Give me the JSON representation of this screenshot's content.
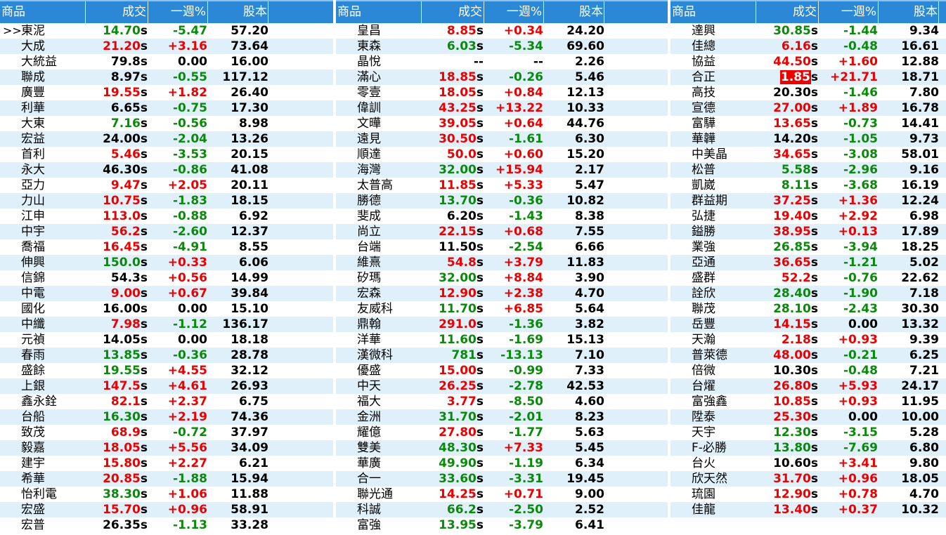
{
  "headers": {
    "name": "商品",
    "price": "成交",
    "change": "一週%",
    "capital": "股本"
  },
  "current_marker": ">>",
  "colors": {
    "header_bg": "#2b88d6",
    "up": "#ee0000",
    "down": "#0a8a0a",
    "row_alt": "#dff0fb"
  },
  "panels": [
    {
      "rows": [
        {
          "name": "東泥",
          "price": "14.70",
          "s": "s",
          "change": "-5.47",
          "capital": "57.20",
          "trend": "down",
          "selected": true
        },
        {
          "name": "大成",
          "price": "21.20",
          "s": "s",
          "change": "+3.16",
          "capital": "73.64",
          "trend": "up"
        },
        {
          "name": "大統益",
          "price": "79.8",
          "s": "s",
          "change": "0.00",
          "capital": "16.00",
          "trend": "flat"
        },
        {
          "name": "聯成",
          "price": "8.97",
          "s": "s",
          "change": "-0.55",
          "capital": "117.12",
          "trend": "flat-down"
        },
        {
          "name": "廣豐",
          "price": "19.55",
          "s": "s",
          "change": "+1.82",
          "capital": "26.40",
          "trend": "up"
        },
        {
          "name": "利華",
          "price": "6.65",
          "s": "s",
          "change": "-0.75",
          "capital": "17.30",
          "trend": "flat-down"
        },
        {
          "name": "大東",
          "price": "7.16",
          "s": "s",
          "change": "-0.56",
          "capital": "8.98",
          "trend": "down"
        },
        {
          "name": "宏益",
          "price": "24.00",
          "s": "s",
          "change": "-2.04",
          "capital": "13.26",
          "trend": "flat-down"
        },
        {
          "name": "首利",
          "price": "5.46",
          "s": "s",
          "change": "-3.53",
          "capital": "20.15",
          "trend": "up-down"
        },
        {
          "name": "永大",
          "price": "46.30",
          "s": "s",
          "change": "-0.86",
          "capital": "41.08",
          "trend": "flat-down"
        },
        {
          "name": "亞力",
          "price": "9.47",
          "s": "s",
          "change": "+2.05",
          "capital": "20.11",
          "trend": "up"
        },
        {
          "name": "力山",
          "price": "10.75",
          "s": "s",
          "change": "-1.83",
          "capital": "18.15",
          "trend": "up-down"
        },
        {
          "name": "江申",
          "price": "113.0",
          "s": "s",
          "change": "-0.88",
          "capital": "6.92",
          "trend": "up-down"
        },
        {
          "name": "中宇",
          "price": "56.2",
          "s": "s",
          "change": "-2.60",
          "capital": "12.37",
          "trend": "up-down"
        },
        {
          "name": "喬福",
          "price": "16.45",
          "s": "s",
          "change": "-4.91",
          "capital": "8.55",
          "trend": "up-down"
        },
        {
          "name": "伸興",
          "price": "150.0",
          "s": "s",
          "change": "+0.33",
          "capital": "6.06",
          "trend": "down-up"
        },
        {
          "name": "信錦",
          "price": "54.3",
          "s": "s",
          "change": "+0.56",
          "capital": "14.99",
          "trend": "flat-up"
        },
        {
          "name": "中電",
          "price": "9.00",
          "s": "s",
          "change": "+0.67",
          "capital": "39.84",
          "trend": "up"
        },
        {
          "name": "國化",
          "price": "16.00",
          "s": "s",
          "change": "0.00",
          "capital": "15.10",
          "trend": "flat"
        },
        {
          "name": "中纖",
          "price": "7.98",
          "s": "s",
          "change": "-1.12",
          "capital": "136.17",
          "trend": "up-down"
        },
        {
          "name": "元禎",
          "price": "14.05",
          "s": "s",
          "change": "0.00",
          "capital": "18.18",
          "trend": "flat"
        },
        {
          "name": "春雨",
          "price": "13.85",
          "s": "s",
          "change": "-0.36",
          "capital": "28.78",
          "trend": "down"
        },
        {
          "name": "盛餘",
          "price": "19.55",
          "s": "s",
          "change": "+4.55",
          "capital": "32.12",
          "trend": "down-up"
        },
        {
          "name": "上銀",
          "price": "147.5",
          "s": "s",
          "change": "+4.61",
          "capital": "26.93",
          "trend": "up"
        },
        {
          "name": "鑫永銓",
          "price": "82.1",
          "s": "s",
          "change": "+2.37",
          "capital": "6.75",
          "trend": "up"
        },
        {
          "name": "台船",
          "price": "16.30",
          "s": "s",
          "change": "+2.19",
          "capital": "74.36",
          "trend": "down-up"
        },
        {
          "name": "致茂",
          "price": "68.9",
          "s": "s",
          "change": "-0.72",
          "capital": "37.97",
          "trend": "up-down"
        },
        {
          "name": "毅嘉",
          "price": "18.05",
          "s": "s",
          "change": "+5.56",
          "capital": "34.09",
          "trend": "up"
        },
        {
          "name": "建宇",
          "price": "15.80",
          "s": "s",
          "change": "+2.27",
          "capital": "6.21",
          "trend": "up"
        },
        {
          "name": "希華",
          "price": "20.85",
          "s": "s",
          "change": "-1.88",
          "capital": "15.94",
          "trend": "up-down"
        },
        {
          "name": "怡利電",
          "price": "38.30",
          "s": "s",
          "change": "+1.06",
          "capital": "11.88",
          "trend": "down-up"
        },
        {
          "name": "宏盛",
          "price": "15.70",
          "s": "s",
          "change": "+0.96",
          "capital": "58.91",
          "trend": "up"
        },
        {
          "name": "宏普",
          "price": "26.35",
          "s": "s",
          "change": "-1.13",
          "capital": "33.28",
          "trend": "flat-down"
        }
      ]
    },
    {
      "rows": [
        {
          "name": "皇昌",
          "price": "8.85",
          "s": "s",
          "change": "+0.34",
          "capital": "24.20",
          "trend": "up"
        },
        {
          "name": "東森",
          "price": "6.03",
          "s": "s",
          "change": "-5.34",
          "capital": "69.60",
          "trend": "down"
        },
        {
          "name": "晶悅",
          "price": "--",
          "s": "",
          "change": "--",
          "capital": "2.26",
          "trend": "flat"
        },
        {
          "name": "滿心",
          "price": "18.85",
          "s": "s",
          "change": "-0.26",
          "capital": "5.46",
          "trend": "up-down"
        },
        {
          "name": "零壹",
          "price": "18.05",
          "s": "s",
          "change": "+0.84",
          "capital": "12.13",
          "trend": "up"
        },
        {
          "name": "偉訓",
          "price": "43.25",
          "s": "s",
          "change": "+13.22",
          "capital": "10.33",
          "trend": "up"
        },
        {
          "name": "文曄",
          "price": "39.05",
          "s": "s",
          "change": "+0.64",
          "capital": "44.76",
          "trend": "up"
        },
        {
          "name": "遠見",
          "price": "30.50",
          "s": "s",
          "change": "-1.61",
          "capital": "6.30",
          "trend": "up-down"
        },
        {
          "name": "順達",
          "price": "50.0",
          "s": "s",
          "change": "+0.60",
          "capital": "15.20",
          "trend": "up"
        },
        {
          "name": "海灣",
          "price": "32.00",
          "s": "s",
          "change": "+15.94",
          "capital": "2.17",
          "trend": "down-up"
        },
        {
          "name": "太普高",
          "price": "11.85",
          "s": "s",
          "change": "+5.33",
          "capital": "5.47",
          "trend": "up"
        },
        {
          "name": "勝德",
          "price": "13.70",
          "s": "s",
          "change": "-0.36",
          "capital": "10.82",
          "trend": "down"
        },
        {
          "name": "斐成",
          "price": "6.20",
          "s": "s",
          "change": "-1.43",
          "capital": "8.38",
          "trend": "flat-down"
        },
        {
          "name": "尚立",
          "price": "22.15",
          "s": "s",
          "change": "+0.68",
          "capital": "7.55",
          "trend": "up"
        },
        {
          "name": "台端",
          "price": "11.50",
          "s": "s",
          "change": "-2.54",
          "capital": "6.66",
          "trend": "flat-down"
        },
        {
          "name": "維熹",
          "price": "54.8",
          "s": "s",
          "change": "+3.79",
          "capital": "11.83",
          "trend": "up"
        },
        {
          "name": "矽瑪",
          "price": "32.00",
          "s": "s",
          "change": "+8.84",
          "capital": "3.90",
          "trend": "down-up"
        },
        {
          "name": "宏森",
          "price": "12.90",
          "s": "s",
          "change": "+2.38",
          "capital": "4.70",
          "trend": "up"
        },
        {
          "name": "友威科",
          "price": "11.70",
          "s": "s",
          "change": "+6.85",
          "capital": "5.64",
          "trend": "down-up"
        },
        {
          "name": "鼎翰",
          "price": "291.0",
          "s": "s",
          "change": "-1.36",
          "capital": "3.82",
          "trend": "up-down"
        },
        {
          "name": "洋華",
          "price": "11.60",
          "s": "s",
          "change": "-1.69",
          "capital": "15.13",
          "trend": "down"
        },
        {
          "name": "漢微科",
          "price": "781",
          "s": "s",
          "change": "-13.13",
          "capital": "7.10",
          "trend": "down"
        },
        {
          "name": "優盛",
          "price": "15.00",
          "s": "s",
          "change": "-0.99",
          "capital": "7.33",
          "trend": "up-down"
        },
        {
          "name": "中天",
          "price": "26.25",
          "s": "s",
          "change": "-2.78",
          "capital": "42.53",
          "trend": "up-down"
        },
        {
          "name": "福大",
          "price": "3.77",
          "s": "s",
          "change": "-8.50",
          "capital": "4.60",
          "trend": "up-down"
        },
        {
          "name": "金洲",
          "price": "31.70",
          "s": "s",
          "change": "-2.01",
          "capital": "8.23",
          "trend": "down"
        },
        {
          "name": "耀億",
          "price": "27.80",
          "s": "s",
          "change": "-1.77",
          "capital": "5.63",
          "trend": "up-down"
        },
        {
          "name": "雙美",
          "price": "48.30",
          "s": "s",
          "change": "+7.33",
          "capital": "5.45",
          "trend": "down-up"
        },
        {
          "name": "華廣",
          "price": "49.90",
          "s": "s",
          "change": "-1.19",
          "capital": "6.34",
          "trend": "down"
        },
        {
          "name": "合一",
          "price": "33.60",
          "s": "s",
          "change": "-3.31",
          "capital": "19.45",
          "trend": "down"
        },
        {
          "name": "聯光通",
          "price": "14.25",
          "s": "s",
          "change": "+0.71",
          "capital": "9.00",
          "trend": "up"
        },
        {
          "name": "科誠",
          "price": "66.2",
          "s": "s",
          "change": "-2.50",
          "capital": "2.52",
          "trend": "down"
        },
        {
          "name": "富強",
          "price": "13.95",
          "s": "s",
          "change": "-3.79",
          "capital": "6.41",
          "trend": "down"
        }
      ]
    },
    {
      "rows": [
        {
          "name": "達興",
          "price": "30.85",
          "s": "s",
          "change": "-1.44",
          "capital": "9.34",
          "trend": "down"
        },
        {
          "name": "佳總",
          "price": "6.16",
          "s": "s",
          "change": "-0.48",
          "capital": "16.61",
          "trend": "up-down"
        },
        {
          "name": "協益",
          "price": "44.50",
          "s": "s",
          "change": "+1.60",
          "capital": "12.88",
          "trend": "up"
        },
        {
          "name": "合正",
          "price": "1.85",
          "s": "s",
          "change": "+21.71",
          "capital": "18.71",
          "trend": "highlight-up"
        },
        {
          "name": "高技",
          "price": "20.30",
          "s": "s",
          "change": "-1.46",
          "capital": "7.80",
          "trend": "flat-down"
        },
        {
          "name": "宣德",
          "price": "27.00",
          "s": "s",
          "change": "+1.89",
          "capital": "16.78",
          "trend": "up"
        },
        {
          "name": "富驊",
          "price": "13.65",
          "s": "s",
          "change": "-0.73",
          "capital": "14.41",
          "trend": "up-down"
        },
        {
          "name": "華韡",
          "price": "14.20",
          "s": "s",
          "change": "-1.05",
          "capital": "9.73",
          "trend": "flat-down"
        },
        {
          "name": "中美晶",
          "price": "34.65",
          "s": "s",
          "change": "-3.08",
          "capital": "58.01",
          "trend": "up-down"
        },
        {
          "name": "松普",
          "price": "5.58",
          "s": "s",
          "change": "-2.96",
          "capital": "9.16",
          "trend": "down"
        },
        {
          "name": "凱崴",
          "price": "8.11",
          "s": "s",
          "change": "-3.68",
          "capital": "16.19",
          "trend": "down"
        },
        {
          "name": "群益期",
          "price": "37.25",
          "s": "s",
          "change": "+1.36",
          "capital": "12.24",
          "trend": "up"
        },
        {
          "name": "弘捷",
          "price": "19.40",
          "s": "s",
          "change": "+2.92",
          "capital": "6.98",
          "trend": "up"
        },
        {
          "name": "鎰勝",
          "price": "38.95",
          "s": "s",
          "change": "+0.13",
          "capital": "17.89",
          "trend": "up"
        },
        {
          "name": "業強",
          "price": "26.85",
          "s": "s",
          "change": "-3.94",
          "capital": "18.25",
          "trend": "down"
        },
        {
          "name": "亞通",
          "price": "36.65",
          "s": "s",
          "change": "-1.21",
          "capital": "5.02",
          "trend": "up-down"
        },
        {
          "name": "盛群",
          "price": "52.2",
          "s": "s",
          "change": "-0.76",
          "capital": "22.62",
          "trend": "up-down"
        },
        {
          "name": "詮欣",
          "price": "28.40",
          "s": "s",
          "change": "-1.90",
          "capital": "7.18",
          "trend": "down"
        },
        {
          "name": "聯茂",
          "price": "28.10",
          "s": "s",
          "change": "-2.43",
          "capital": "30.30",
          "trend": "down"
        },
        {
          "name": "岳豐",
          "price": "14.15",
          "s": "s",
          "change": "0.00",
          "capital": "13.32",
          "trend": "up-flat"
        },
        {
          "name": "天瀚",
          "price": "2.18",
          "s": "s",
          "change": "+0.93",
          "capital": "9.39",
          "trend": "up"
        },
        {
          "name": "普萊德",
          "price": "48.00",
          "s": "s",
          "change": "-0.21",
          "capital": "6.25",
          "trend": "up-down"
        },
        {
          "name": "倍微",
          "price": "10.30",
          "s": "s",
          "change": "-0.48",
          "capital": "7.21",
          "trend": "flat-down"
        },
        {
          "name": "台燿",
          "price": "26.80",
          "s": "s",
          "change": "+5.93",
          "capital": "24.17",
          "trend": "up"
        },
        {
          "name": "富強鑫",
          "price": "10.85",
          "s": "s",
          "change": "+0.93",
          "capital": "11.95",
          "trend": "up"
        },
        {
          "name": "陞泰",
          "price": "25.30",
          "s": "s",
          "change": "0.00",
          "capital": "10.00",
          "trend": "up-flat"
        },
        {
          "name": "天宇",
          "price": "12.30",
          "s": "s",
          "change": "-3.15",
          "capital": "5.28",
          "trend": "down"
        },
        {
          "name": "F-必勝",
          "price": "13.80",
          "s": "s",
          "change": "-7.69",
          "capital": "6.80",
          "trend": "down"
        },
        {
          "name": "台火",
          "price": "10.60",
          "s": "s",
          "change": "+3.41",
          "capital": "9.80",
          "trend": "flat-up"
        },
        {
          "name": "欣天然",
          "price": "31.70",
          "s": "s",
          "change": "+0.96",
          "capital": "18.05",
          "trend": "up"
        },
        {
          "name": "琉園",
          "price": "12.90",
          "s": "s",
          "change": "+0.78",
          "capital": "4.70",
          "trend": "up"
        },
        {
          "name": "佳龍",
          "price": "13.40",
          "s": "s",
          "change": "+0.37",
          "capital": "10.32",
          "trend": "up"
        }
      ]
    }
  ]
}
